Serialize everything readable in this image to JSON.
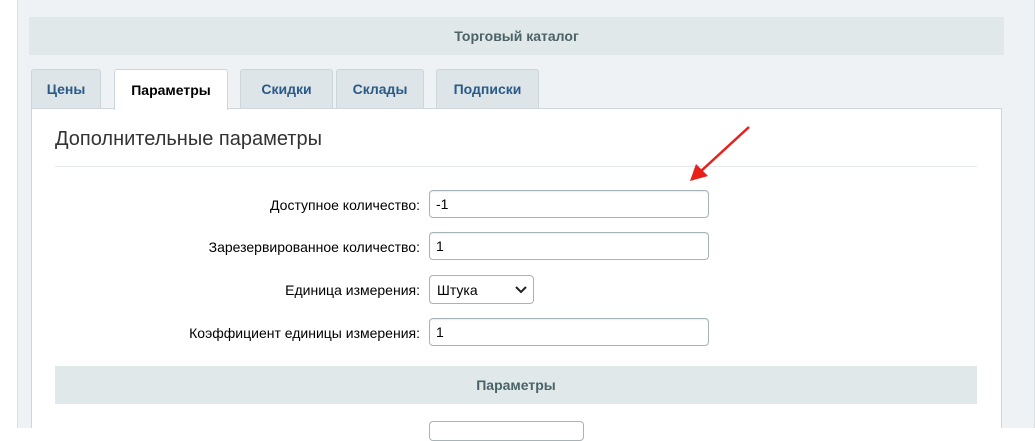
{
  "catalog": {
    "title": "Торговый каталог"
  },
  "tabs": [
    {
      "label": "Цены",
      "active": false
    },
    {
      "label": "Параметры",
      "active": true
    },
    {
      "label": "Скидки",
      "active": false
    },
    {
      "label": "Склады",
      "active": false
    },
    {
      "label": "Подписки",
      "active": false
    }
  ],
  "panel": {
    "title": "Дополнительные параметры",
    "fields": {
      "available_qty": {
        "label": "Доступное количество:",
        "value": "-1"
      },
      "reserved_qty": {
        "label": "Зарезервированное количество:",
        "value": "1"
      },
      "unit": {
        "label": "Единица измерения:",
        "selected": "Штука"
      },
      "unit_ratio": {
        "label": "Коэффициент единицы измерения:",
        "value": "1"
      }
    }
  },
  "params_section": {
    "title": "Параметры"
  },
  "annotation": {
    "arrow_color": "#e8201a",
    "icon": "red-arrow-icon"
  },
  "colors": {
    "tab_text": "#2a5a86",
    "header_bg": "#e0e8ea",
    "header_text": "#4b6267"
  }
}
